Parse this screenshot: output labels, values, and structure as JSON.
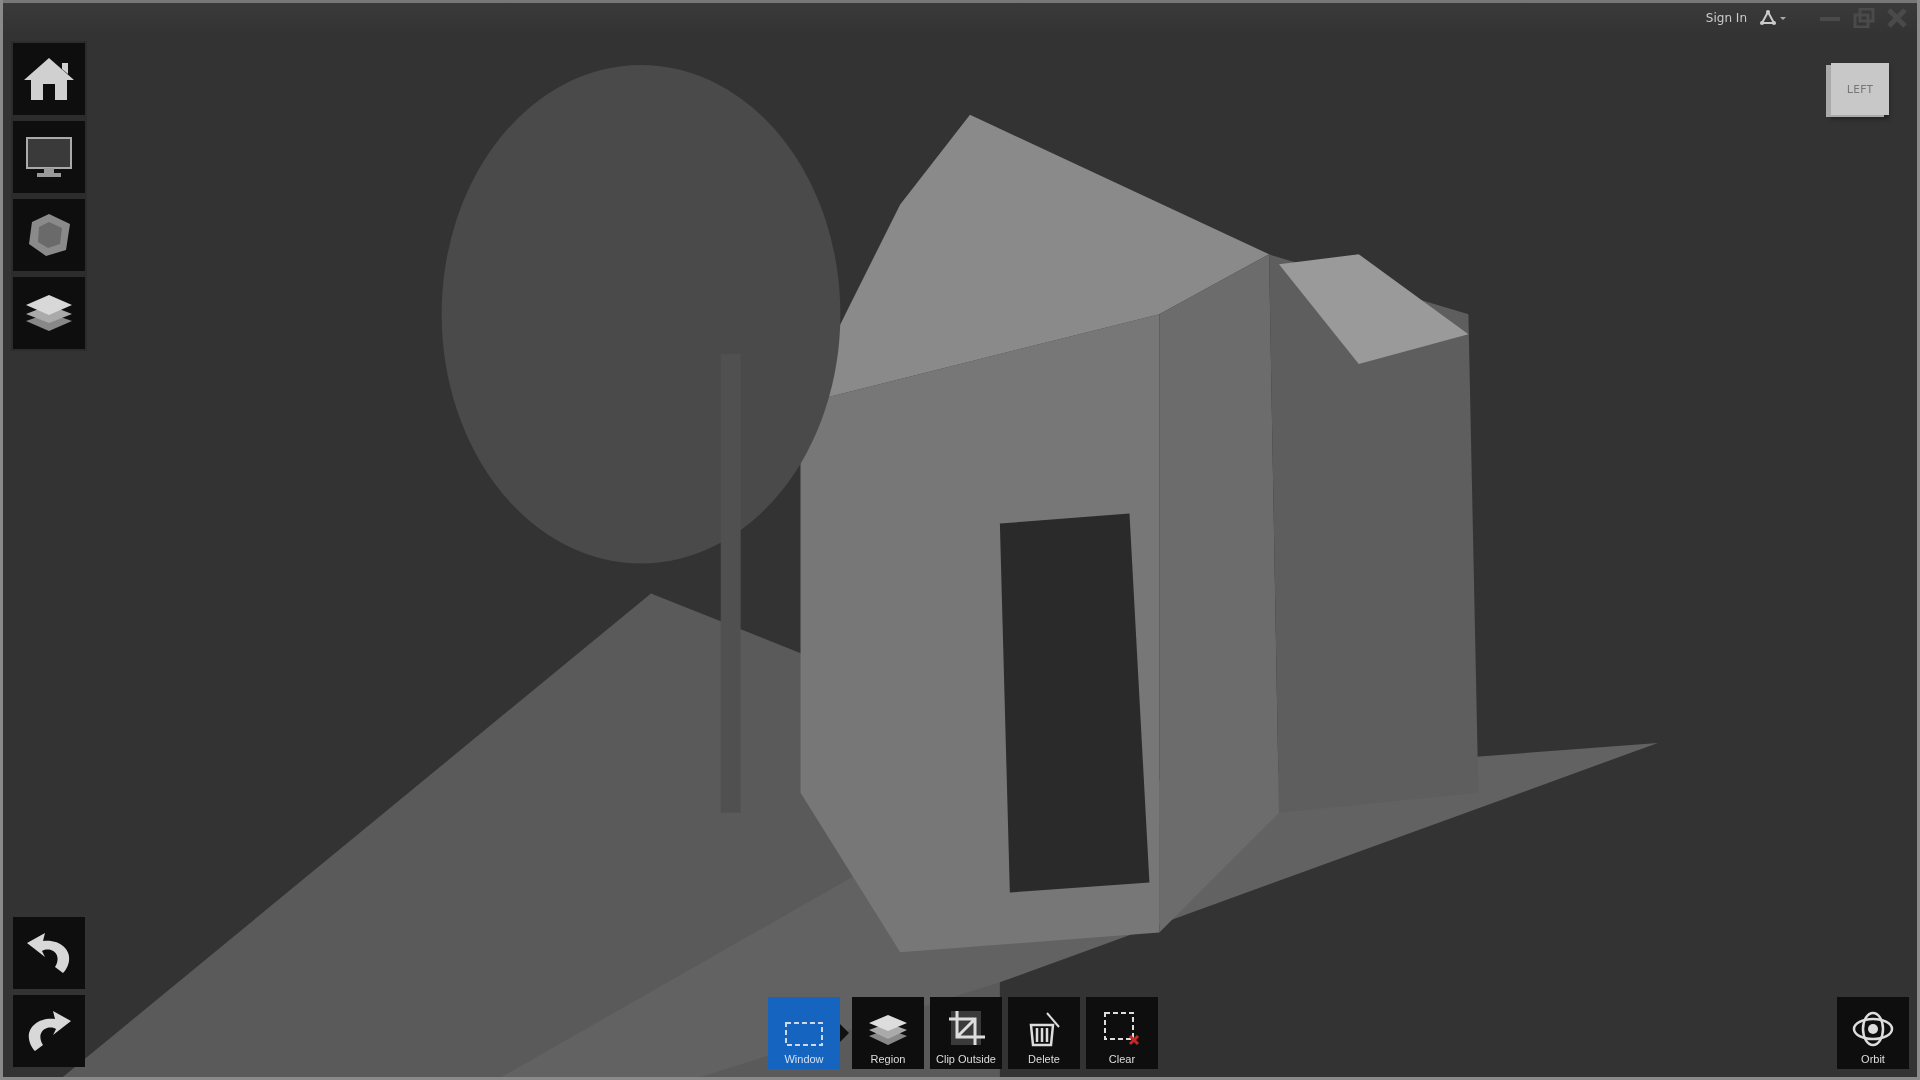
{
  "title_bar": {
    "sign_in": "Sign In"
  },
  "view_cube": {
    "face": "LEFT"
  },
  "left_toolbar": [
    {
      "kind": "home"
    },
    {
      "kind": "display"
    },
    {
      "kind": "cube"
    },
    {
      "kind": "layers"
    }
  ],
  "history_toolbar": [
    {
      "kind": "undo"
    },
    {
      "kind": "redo"
    }
  ],
  "selection_toolbar": [
    {
      "kind": "window",
      "label": "Window",
      "selected": true
    },
    {
      "kind": "region",
      "label": "Region",
      "selected": false
    },
    {
      "kind": "clip",
      "label": "Clip Outside",
      "selected": false
    },
    {
      "kind": "delete",
      "label": "Delete",
      "selected": false
    },
    {
      "kind": "clear",
      "label": "Clear",
      "selected": false
    }
  ],
  "navigation": {
    "label": "Orbit"
  }
}
